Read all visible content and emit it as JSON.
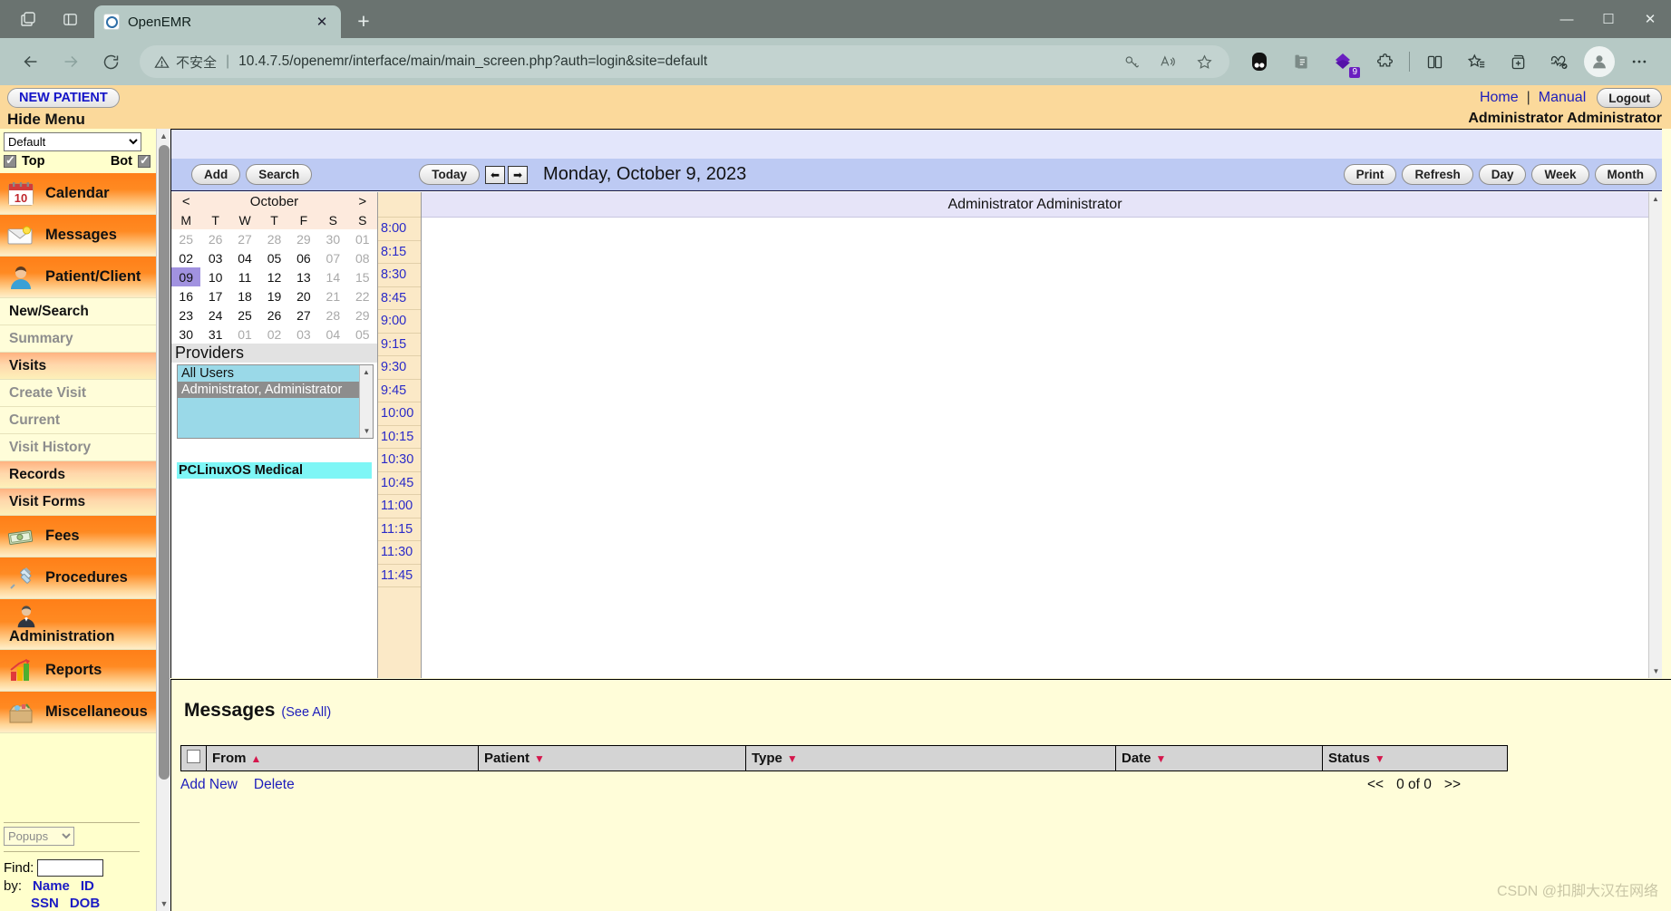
{
  "browser": {
    "tab": {
      "title": "OpenEMR",
      "favicon": "openemr-favicon",
      "close": "✕"
    },
    "newtab_label": "+",
    "window_controls": {
      "minimize": "—",
      "maximize": "☐",
      "close": "✕"
    },
    "nav": {
      "back": "←",
      "forward": "→",
      "reload": "⟳"
    },
    "omnibox": {
      "security_label": "不安全",
      "separator": "|",
      "url": "10.4.7.5/openemr/interface/main/main_screen.php?auth=login&site=default"
    },
    "toolbar_icons": [
      "key-icon",
      "read-aloud-icon",
      "favorite-star-icon",
      "split-circle-extension-icon",
      "collections-icon",
      "purple-diamond-extension-icon",
      "puzzle-extensions-icon",
      "split-screen-icon",
      "favorites-list-icon",
      "add-collection-icon",
      "browser-essentials-icon",
      "profile-avatar-icon",
      "settings-more-icon"
    ],
    "extension_badge": "9"
  },
  "topbar": {
    "new_patient": "NEW PATIENT",
    "hide_menu": "Hide Menu",
    "home": "Home",
    "divider": "|",
    "manual": "Manual",
    "logout": "Logout",
    "username": "Administrator Administrator"
  },
  "sidebar": {
    "theme_select": "Default",
    "top_label": "Top",
    "bot_label": "Bot",
    "items": [
      {
        "label": "Calendar",
        "icon": "calendar-icon",
        "style": "major"
      },
      {
        "label": "Messages",
        "icon": "envelope-icon",
        "style": "major"
      },
      {
        "label": "Patient/Client",
        "icon": "person-icon",
        "style": "major"
      },
      {
        "label": "New/Search",
        "icon": "",
        "style": "plain"
      },
      {
        "label": "Summary",
        "icon": "",
        "style": "plain-dim"
      },
      {
        "label": "Visits",
        "icon": "",
        "style": "sub-major"
      },
      {
        "label": "Create Visit",
        "icon": "",
        "style": "plain-dim"
      },
      {
        "label": "Current",
        "icon": "",
        "style": "plain-dim"
      },
      {
        "label": "Visit History",
        "icon": "",
        "style": "plain-dim"
      },
      {
        "label": "Records",
        "icon": "",
        "style": "sub-major"
      },
      {
        "label": "Visit Forms",
        "icon": "",
        "style": "sub-major"
      },
      {
        "label": "Fees",
        "icon": "money-icon",
        "style": "major"
      },
      {
        "label": "Procedures",
        "icon": "syringe-icon",
        "style": "major"
      },
      {
        "label": "Administration",
        "icon": "admin-person-icon",
        "style": "major-stacked"
      },
      {
        "label": "Reports",
        "icon": "bar-chart-icon",
        "style": "major"
      },
      {
        "label": "Miscellaneous",
        "icon": "box-icon",
        "style": "major"
      }
    ],
    "popups_select": "Popups",
    "find_label": "Find:",
    "find_value": "",
    "by_label": "by:",
    "by_links": [
      "Name",
      "ID",
      "SSN",
      "DOB"
    ]
  },
  "calendar": {
    "add_button": "Add",
    "search_button": "Search",
    "today_button": "Today",
    "prev_arrow": "⬅",
    "next_arrow": "➡",
    "date_title": "Monday, October 9, 2023",
    "right_buttons": [
      "Print",
      "Refresh",
      "Day",
      "Week",
      "Month"
    ],
    "column_header": "Administrator Administrator",
    "mini": {
      "prev": "<",
      "month": "October",
      "next": ">",
      "weekdays": [
        "M",
        "T",
        "W",
        "T",
        "F",
        "S",
        "S"
      ],
      "weeks": [
        [
          "25",
          "26",
          "27",
          "28",
          "29",
          "30",
          "01"
        ],
        [
          "02",
          "03",
          "04",
          "05",
          "06",
          "07",
          "08"
        ],
        [
          "09",
          "10",
          "11",
          "12",
          "13",
          "14",
          "15"
        ],
        [
          "16",
          "17",
          "18",
          "19",
          "20",
          "21",
          "22"
        ],
        [
          "23",
          "24",
          "25",
          "26",
          "27",
          "28",
          "29"
        ],
        [
          "30",
          "31",
          "01",
          "02",
          "03",
          "04",
          "05"
        ]
      ],
      "selected_day": "09"
    },
    "providers_label": "Providers",
    "providers": [
      "All Users",
      "Administrator, Administrator"
    ],
    "provider_selected": "Administrator, Administrator",
    "facility": "PCLinuxOS Medical",
    "times": [
      "8:00",
      "8:15",
      "8:30",
      "8:45",
      "9:00",
      "9:15",
      "9:30",
      "9:45",
      "10:00",
      "10:15",
      "10:30",
      "10:45",
      "11:00",
      "11:15",
      "11:30",
      "11:45"
    ]
  },
  "messages": {
    "title": "Messages",
    "see_all": "(See All)",
    "columns": [
      {
        "label": "From",
        "sort": "▲"
      },
      {
        "label": "Patient",
        "sort": "▼"
      },
      {
        "label": "Type",
        "sort": "▼"
      },
      {
        "label": "Date",
        "sort": "▼"
      },
      {
        "label": "Status",
        "sort": "▼"
      }
    ],
    "add_new": "Add New",
    "delete": "Delete",
    "pager_prev": "<<",
    "pager_count": "0 of 0",
    "pager_next": ">>"
  },
  "watermark": "CSDN @扣脚大汉在网络"
}
